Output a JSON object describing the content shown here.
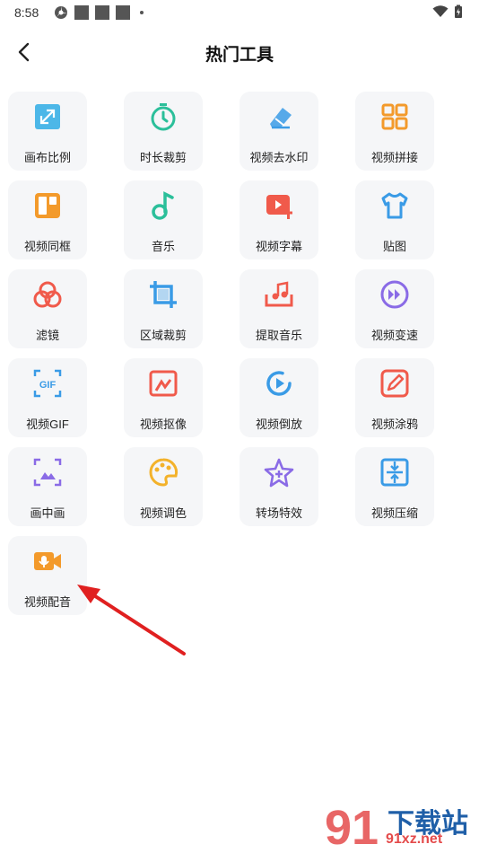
{
  "status": {
    "time": "8:58"
  },
  "header": {
    "title": "热门工具"
  },
  "tools": [
    {
      "label": "画布比例",
      "icon": "canvas-ratio-icon",
      "color": "#3ab0e6"
    },
    {
      "label": "时长裁剪",
      "icon": "timer-icon",
      "color": "#2bbf9a"
    },
    {
      "label": "视频去水印",
      "icon": "eraser-icon",
      "color": "#3a9be6"
    },
    {
      "label": "视频拼接",
      "icon": "grid-join-icon",
      "color": "#f39a2b"
    },
    {
      "label": "视频同框",
      "icon": "split-frame-icon",
      "color": "#f39a2b"
    },
    {
      "label": "音乐",
      "icon": "music-note-icon",
      "color": "#2bbf9a"
    },
    {
      "label": "视频字幕",
      "icon": "subtitle-icon",
      "color": "#f05a4b"
    },
    {
      "label": "贴图",
      "icon": "shirt-icon",
      "color": "#3a9be6"
    },
    {
      "label": "滤镜",
      "icon": "filter-icon",
      "color": "#f05a4b"
    },
    {
      "label": "区域裁剪",
      "icon": "crop-icon",
      "color": "#3a9be6"
    },
    {
      "label": "提取音乐",
      "icon": "extract-music-icon",
      "color": "#f05a4b"
    },
    {
      "label": "视频变速",
      "icon": "speed-icon",
      "color": "#8a6be6"
    },
    {
      "label": "视频GIF",
      "icon": "gif-icon",
      "color": "#3a9be6"
    },
    {
      "label": "视频抠像",
      "icon": "cutout-icon",
      "color": "#f05a4b"
    },
    {
      "label": "视频倒放",
      "icon": "reverse-icon",
      "color": "#3a9be6"
    },
    {
      "label": "视频涂鸦",
      "icon": "doodle-icon",
      "color": "#f05a4b"
    },
    {
      "label": "画中画",
      "icon": "pip-icon",
      "color": "#8a6be6"
    },
    {
      "label": "视频调色",
      "icon": "palette-icon",
      "color": "#f3b22b"
    },
    {
      "label": "转场特效",
      "icon": "transition-star-icon",
      "color": "#8a6be6"
    },
    {
      "label": "视频压缩",
      "icon": "compress-icon",
      "color": "#3a9be6"
    },
    {
      "label": "视频配音",
      "icon": "voiceover-camera-icon",
      "color": "#f39a2b"
    }
  ],
  "watermark": {
    "brand": "下载站",
    "url": "91xz.net",
    "logo": "91"
  }
}
